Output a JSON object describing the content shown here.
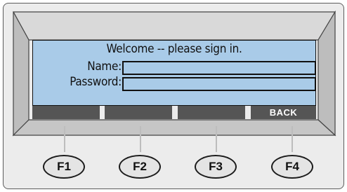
{
  "screen": {
    "welcome": "Welcome -- please sign in.",
    "fields": [
      {
        "label": "Name:",
        "value": ""
      },
      {
        "label": "Password:",
        "value": ""
      }
    ]
  },
  "softkeys": [
    "",
    "",
    "",
    "BACK"
  ],
  "function_keys": [
    "F1",
    "F2",
    "F3",
    "F4"
  ],
  "colors": {
    "screen": "#a9cbe8",
    "softkey": "#555555",
    "bezel": "#c8c8c8",
    "body": "#ececec"
  }
}
